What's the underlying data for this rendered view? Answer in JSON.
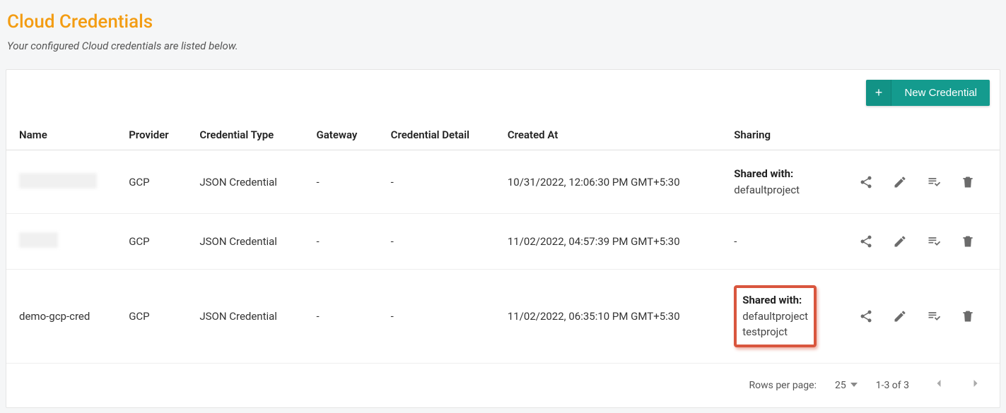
{
  "header": {
    "title": "Cloud Credentials",
    "subtitle": "Your configured Cloud credentials are listed below."
  },
  "toolbar": {
    "new_credential_label": "New Credential",
    "plus_glyph": "+"
  },
  "table": {
    "columns": {
      "name": "Name",
      "provider": "Provider",
      "credential_type": "Credential Type",
      "gateway": "Gateway",
      "credential_detail": "Credential Detail",
      "created_at": "Created At",
      "sharing": "Sharing"
    },
    "rows": [
      {
        "name": "",
        "name_redacted": true,
        "redaction_class": "",
        "provider": "GCP",
        "credential_type": "JSON Credential",
        "gateway": "-",
        "credential_detail": "-",
        "created_at": "10/31/2022, 12:06:30 PM GMT+5:30",
        "sharing_label": "Shared with:",
        "sharing_items": [
          "defaultproject"
        ],
        "sharing_none": false,
        "highlight": false
      },
      {
        "name": "",
        "name_redacted": true,
        "redaction_class": "short",
        "provider": "GCP",
        "credential_type": "JSON Credential",
        "gateway": "-",
        "credential_detail": "-",
        "created_at": "11/02/2022, 04:57:39 PM GMT+5:30",
        "sharing_label": "",
        "sharing_items": [],
        "sharing_none": true,
        "sharing_none_text": "-",
        "highlight": false
      },
      {
        "name": "demo-gcp-cred",
        "name_redacted": false,
        "provider": "GCP",
        "credential_type": "JSON Credential",
        "gateway": "-",
        "credential_detail": "-",
        "created_at": "11/02/2022, 06:35:10 PM GMT+5:30",
        "sharing_label": "Shared with:",
        "sharing_items": [
          "defaultproject",
          "testprojct"
        ],
        "sharing_none": false,
        "highlight": true
      }
    ]
  },
  "footer": {
    "rows_per_page_label": "Rows per page:",
    "rows_per_page_value": "25",
    "range_text": "1-3 of 3"
  },
  "icons": {
    "share": "share-icon",
    "edit": "pencil-icon",
    "playlist_check": "playlist-check-icon",
    "delete": "trash-icon",
    "prev": "chevron-left-icon",
    "next": "chevron-right-icon",
    "dropdown": "caret-down-icon"
  }
}
